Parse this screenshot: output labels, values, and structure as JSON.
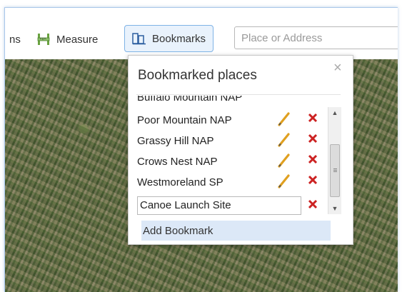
{
  "toolbar": {
    "partial_label": "ns",
    "measure_label": "Measure",
    "bookmarks_label": "Bookmarks",
    "search_placeholder": "Place or Address"
  },
  "popup": {
    "title": "Bookmarked places",
    "close_glyph": "×",
    "partial_item": "Buffalo Mountain NAP",
    "items": [
      {
        "label": "Poor Mountain NAP"
      },
      {
        "label": "Grassy Hill NAP"
      },
      {
        "label": "Crows Nest NAP"
      },
      {
        "label": "Westmoreland SP"
      }
    ],
    "new_bookmark_value": "Canoe Launch Site",
    "add_button_label": "Add Bookmark"
  },
  "colors": {
    "accent": "#7fb3e6",
    "delete": "#cc2222",
    "edit": "#e0a020"
  }
}
